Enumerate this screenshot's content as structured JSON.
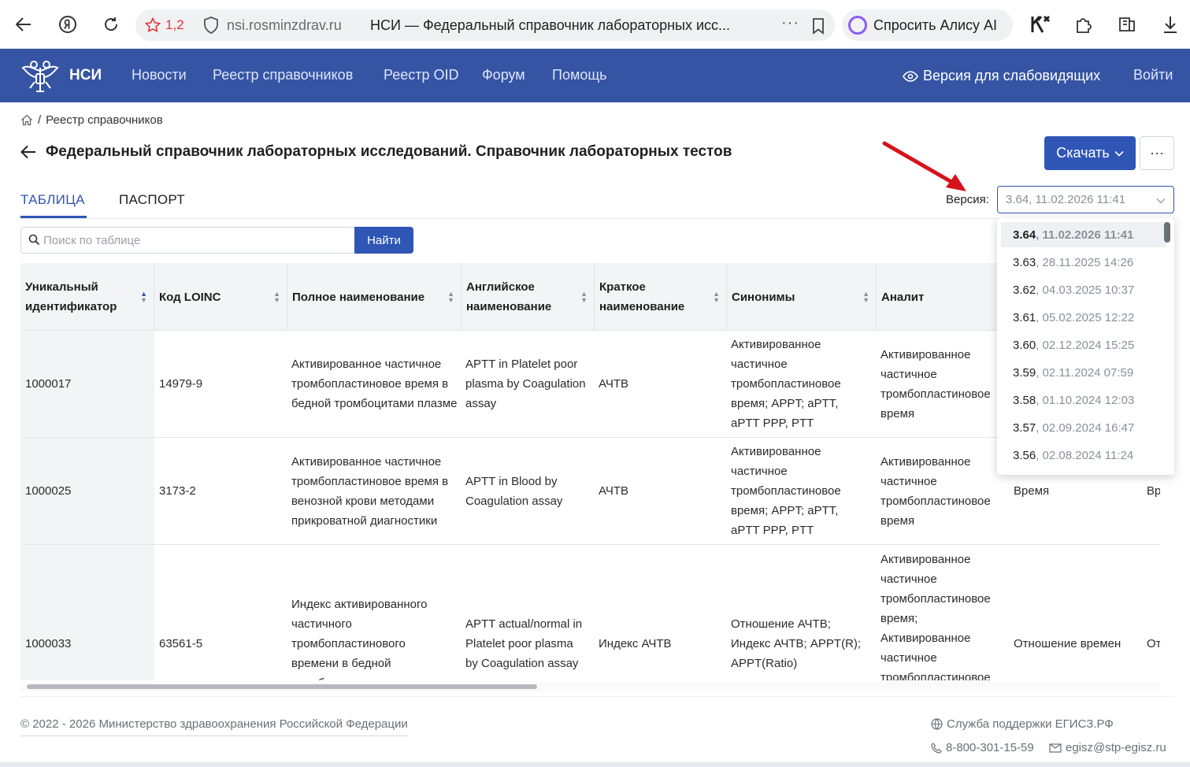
{
  "browser": {
    "rating": "1,2",
    "domain": "nsi.rosminzdrav.ru",
    "page_title": "НСИ — Федеральный справочник лабораторных исс...",
    "more": "···",
    "alice_label": "Спросить Алису AI"
  },
  "header": {
    "brand": "НСИ",
    "nav": [
      "Новости",
      "Реестр справочников",
      "Реестр OID",
      "Форум",
      "Помощь"
    ],
    "vision_label": "Версия для слабовидящих",
    "login_label": "Войти"
  },
  "breadcrumb": {
    "separator": "/",
    "current": "Реестр справочников"
  },
  "page": {
    "title": "Федеральный справочник лабораторных исследований. Справочник лабораторных тестов",
    "download_label": "Скачать",
    "more_label": "···"
  },
  "tabs": [
    {
      "label": "ТАБЛИЦА",
      "active": true
    },
    {
      "label": "ПАСПОРТ",
      "active": false
    }
  ],
  "version": {
    "label": "Версия:",
    "selected_number": "3.64",
    "selected_date": ", 11.02.2026 11:41",
    "options": [
      {
        "number": "3.64",
        "date": ", 11.02.2026 11:41",
        "selected": true
      },
      {
        "number": "3.63",
        "date": ", 28.11.2025 14:26"
      },
      {
        "number": "3.62",
        "date": ", 04.03.2025 10:37"
      },
      {
        "number": "3.61",
        "date": ", 05.02.2025 12:22"
      },
      {
        "number": "3.60",
        "date": ", 02.12.2024 15:25"
      },
      {
        "number": "3.59",
        "date": ", 02.11.2024 07:59"
      },
      {
        "number": "3.58",
        "date": ", 01.10.2024 12:03"
      },
      {
        "number": "3.57",
        "date": ", 02.09.2024 16:47"
      },
      {
        "number": "3.56",
        "date": ", 02.08.2024 11:24"
      }
    ]
  },
  "search": {
    "placeholder": "Поиск по таблице",
    "button_label": "Найти"
  },
  "table": {
    "columns": [
      "Уникальный идентификатор",
      "Код LOINC",
      "Полное наименование",
      "Английское наименование",
      "Краткое наименование",
      "Синонимы",
      "Аналит"
    ],
    "rows": [
      {
        "id": "1000017",
        "loinc": "14979-9",
        "full": "Активированное частичное тромбопластиновое время в бедной тромбоцитами плазме",
        "eng": "APTT in Platelet poor plasma by Coagulation assay",
        "short": "АЧТВ",
        "syn": "Активированное частичное тромбопластиновое время; APPT; aPTT, aPTT PPP, PTT",
        "analyte": "Активированное частичное тромбопластиновое время",
        "c8": "",
        "c9": ""
      },
      {
        "id": "1000025",
        "loinc": "3173-2",
        "full": "Активированное частичное тромбопластиновое время в венозной крови методами прикроватной диагностики",
        "eng": "APTT in Blood by Coagulation assay",
        "short": "АЧТВ",
        "syn": "Активированное частичное тромбопластиновое время; APPT; aPTT, aPTT PPP, PTT",
        "analyte": "Активированное частичное тромбопластиновое время",
        "c8": "Время",
        "c9": "Вр"
      },
      {
        "id": "1000033",
        "loinc": "63561-5",
        "full": "Индекс активированного частичного тромбопластинового времени в бедной тромбоцитами плазме",
        "eng": "APTT actual/normal in Platelet poor plasma by Coagulation assay",
        "short": "Индекс АЧТВ",
        "syn": "Отношение АЧТВ; Индекс АЧТВ; APPT(R); APPT(Ratio)",
        "analyte": "Активированное частичное тромбопластиновое время; Активированное частичное тромбопластиновое",
        "c8": "Отношение времен",
        "c9": "От"
      }
    ]
  },
  "footer": {
    "copyright": "© 2022 - 2026 Министерство здравоохранения Российской Федерации",
    "support": "Служба поддержки ЕГИСЗ.РФ",
    "phone": "8-800-301-15-59",
    "email": "egisz@stp-egisz.ru"
  },
  "colors": {
    "header_bg": "#3554a4",
    "accent": "#2f55b5",
    "annotation_arrow": "#d6131b"
  }
}
